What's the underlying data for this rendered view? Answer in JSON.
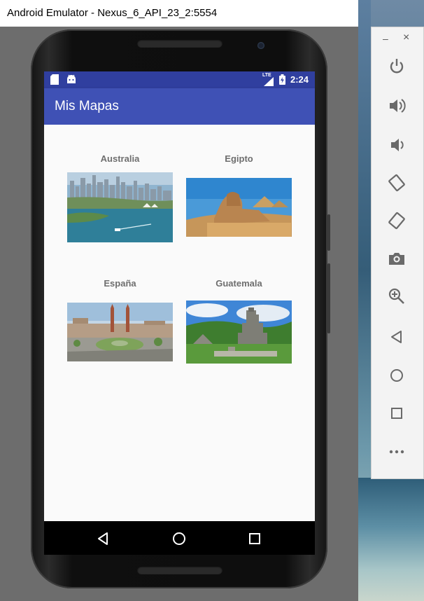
{
  "window": {
    "title": "Android Emulator - Nexus_6_API_23_2:5554"
  },
  "status_bar": {
    "time": "2:24",
    "network_badge": "LTE",
    "left_icons": [
      "sd-card-icon",
      "android-icon"
    ],
    "right_icons": [
      "signal-icon",
      "battery-icon"
    ],
    "color": "#303f9f"
  },
  "app_bar": {
    "title": "Mis Mapas",
    "color": "#3f51b5"
  },
  "destinations": [
    {
      "label": "Australia",
      "image": "sydney-harbour-photo"
    },
    {
      "label": "Egipto",
      "image": "sphinx-pyramids-photo"
    },
    {
      "label": "España",
      "image": "barcelona-plaza-photo"
    },
    {
      "label": "Guatemala",
      "image": "tikal-temple-photo"
    }
  ],
  "nav_bar": {
    "buttons": [
      "back",
      "home",
      "recents"
    ]
  },
  "side_panel": {
    "minimize": "–",
    "close": "×",
    "tools": [
      {
        "name": "power",
        "icon": "power-icon"
      },
      {
        "name": "volume-up",
        "icon": "volume-up-icon"
      },
      {
        "name": "volume-down",
        "icon": "volume-down-icon"
      },
      {
        "name": "rotate-left",
        "icon": "rotate-left-icon"
      },
      {
        "name": "rotate-right",
        "icon": "rotate-right-icon"
      },
      {
        "name": "screenshot",
        "icon": "camera-icon"
      },
      {
        "name": "zoom",
        "icon": "zoom-icon"
      },
      {
        "name": "back",
        "icon": "back-triangle-icon"
      },
      {
        "name": "home",
        "icon": "home-circle-icon"
      },
      {
        "name": "overview",
        "icon": "overview-square-icon"
      },
      {
        "name": "more",
        "icon": "more-icon"
      }
    ]
  }
}
